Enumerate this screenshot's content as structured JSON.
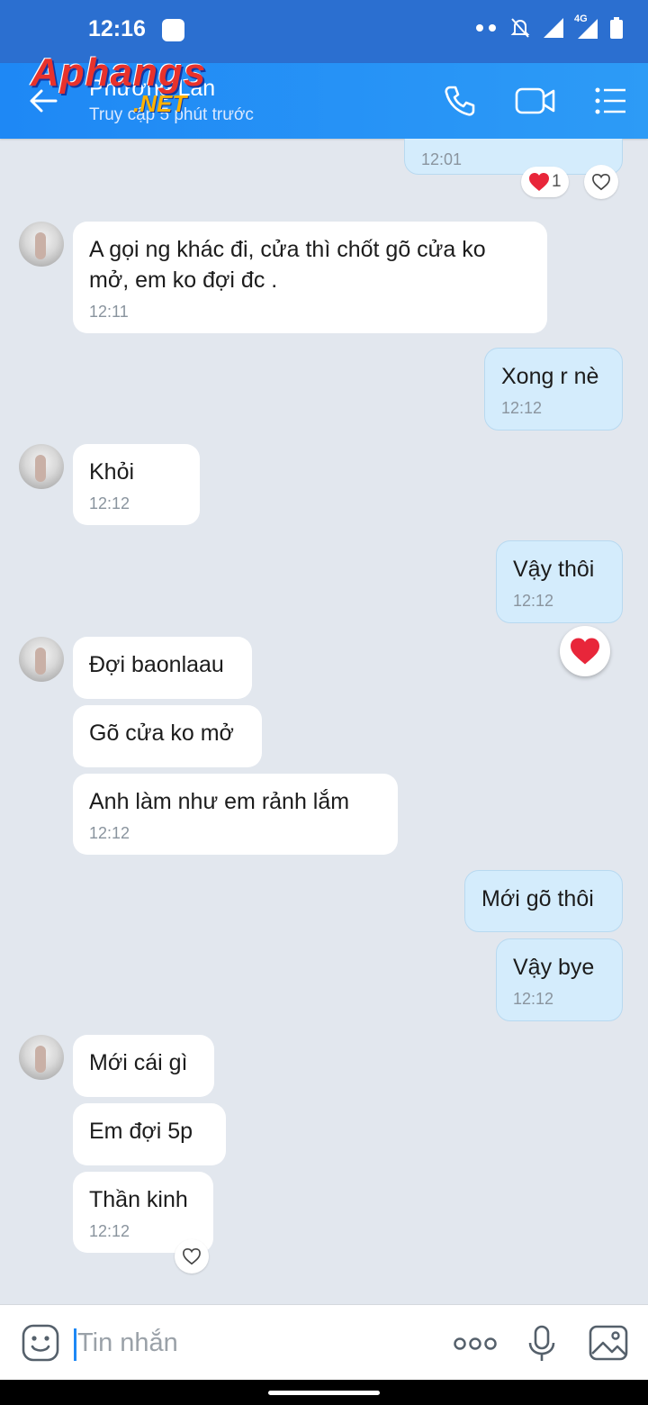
{
  "status_bar": {
    "time": "12:16",
    "network": "4G",
    "icons": [
      "app-notification-icon",
      "dots-icon",
      "mute-icon",
      "signal-icon",
      "signal-4g-icon",
      "battery-icon"
    ]
  },
  "header": {
    "contact_name": "Phương Lan",
    "last_seen": "Truy cập 5 phút trước",
    "watermark_main": "Aphangs",
    "watermark_sub": ".NET",
    "icons": [
      "back-arrow-icon",
      "phone-icon",
      "video-call-icon",
      "menu-icon"
    ]
  },
  "messages": {
    "m0": {
      "time": "12:01",
      "reaction_count": "1"
    },
    "m1": {
      "text": "A gọi ng khác đi, cửa thì chốt gõ cửa ko mở, em ko đợi đc .",
      "time": "12:11"
    },
    "m2": {
      "text": "Xong r nè",
      "time": "12:12"
    },
    "m3": {
      "text": "Khỏi",
      "time": "12:12"
    },
    "m4": {
      "text": "Vậy thôi",
      "time": "12:12"
    },
    "m5": {
      "text": "Đợi baonlaau"
    },
    "m6": {
      "text": "Gõ cửa ko mở"
    },
    "m7": {
      "text": "Anh làm như em rảnh lắm",
      "time": "12:12"
    },
    "m8": {
      "text": "Mới gõ thôi"
    },
    "m9": {
      "text": "Vậy bye",
      "time": "12:12"
    },
    "m10": {
      "text": "Mới cái gì"
    },
    "m11": {
      "text": "Em đợi 5p"
    },
    "m12": {
      "text": "Thần kinh",
      "time": "12:12"
    }
  },
  "input": {
    "placeholder": "Tin nhắn",
    "icons": [
      "emoji-sticker-icon",
      "more-dots-icon",
      "microphone-icon",
      "image-gallery-icon"
    ]
  },
  "colors": {
    "header": "#1e88f5",
    "status_bar": "#2b6fd0",
    "chat_background": "#e2e7ee",
    "incoming_bubble": "#ffffff",
    "outgoing_bubble": "#d4ecfc",
    "heart": "#e8263a"
  }
}
